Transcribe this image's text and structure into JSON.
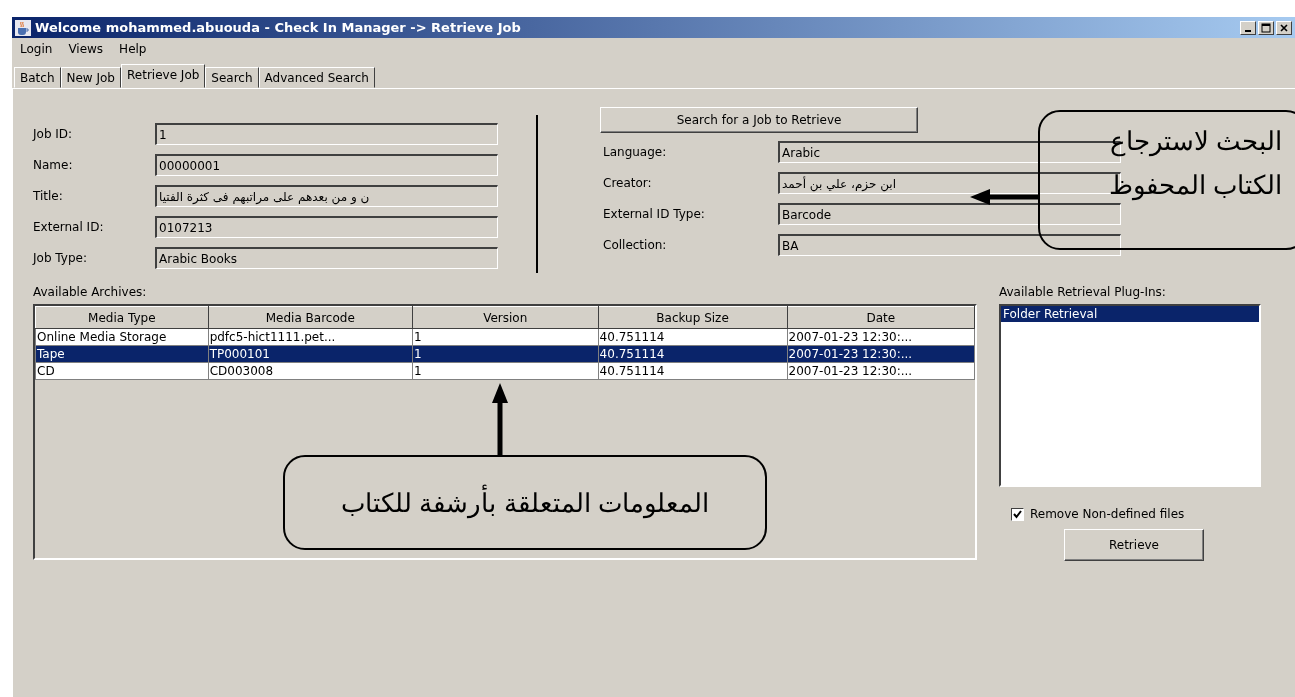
{
  "window": {
    "title": "Welcome mohammed.abuouda - Check In Manager -> Retrieve Job"
  },
  "menu": [
    {
      "label": "Login"
    },
    {
      "label": "Views"
    },
    {
      "label": "Help"
    }
  ],
  "tabs": [
    {
      "label": "Batch",
      "selected": false
    },
    {
      "label": "New Job",
      "selected": false
    },
    {
      "label": "Retrieve Job",
      "selected": true
    },
    {
      "label": "Search",
      "selected": false
    },
    {
      "label": "Advanced Search",
      "selected": false
    }
  ],
  "job_fields": [
    {
      "label": "Job ID:",
      "value": "1"
    },
    {
      "label": "Name:",
      "value": "00000001"
    },
    {
      "label": "Title:",
      "value": "ن و من بعدهم على مراتبهم فى كثرة الفتيا",
      "rtl": true
    },
    {
      "label": "External ID:",
      "value": "0107213"
    },
    {
      "label": "Job Type:",
      "value": "Arabic Books"
    }
  ],
  "search_button": "Search for a Job to Retrieve",
  "detail_fields": [
    {
      "label": "Language:",
      "value": "Arabic"
    },
    {
      "label": "Creator:",
      "value": "ابن حزم، علي بن أحمد",
      "rtl": true
    },
    {
      "label": "External ID Type:",
      "value": "Barcode"
    },
    {
      "label": "Collection:",
      "value": "BA"
    }
  ],
  "archives": {
    "label": "Available Archives:",
    "columns": [
      "Media Type",
      "Media Barcode",
      "Version",
      "Backup Size",
      "Date"
    ],
    "rows": [
      {
        "cells": [
          "Online Media Storage",
          "pdfc5-hict1111.pet...",
          "1",
          "40.751114",
          "2007-01-23 12:30:..."
        ],
        "selected": false
      },
      {
        "cells": [
          "Tape",
          "TP000101",
          "1",
          "40.751114",
          "2007-01-23 12:30:..."
        ],
        "selected": true
      },
      {
        "cells": [
          "CD",
          "CD003008",
          "1",
          "40.751114",
          "2007-01-23 12:30:..."
        ],
        "selected": false
      }
    ]
  },
  "plugins": {
    "label": "Available Retrieval Plug-Ins:",
    "items": [
      {
        "label": "Folder Retrieval",
        "selected": true
      }
    ]
  },
  "remove_option": {
    "label": "Remove Non-defined files",
    "checked": true
  },
  "retrieve_button": "Retrieve",
  "annotations": [
    {
      "lines": [
        "البحث لاسترجاع",
        "الكتاب المحفوظ"
      ],
      "kind": "arrow_left"
    },
    {
      "lines": [
        "المعلومات المتعلقة بأرشفة للكتاب"
      ],
      "kind": "arrow_up"
    }
  ]
}
